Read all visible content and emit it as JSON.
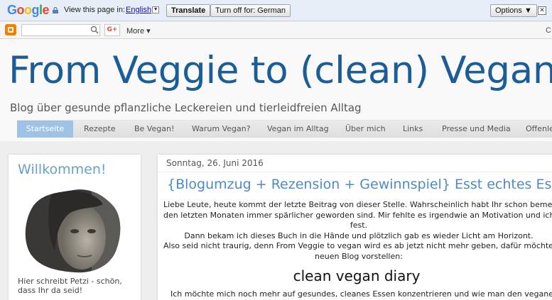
{
  "translate_bar": {
    "logo_letters": [
      "G",
      "o",
      "o",
      "g",
      "l",
      "e"
    ],
    "prompt": "View this page in:",
    "language": "English",
    "translate_label": "Translate",
    "turn_off_label": "Turn off for: German",
    "options_label": "Options ▼",
    "close_label": "✕"
  },
  "navbar": {
    "gplus_label": "G+",
    "more_label": "More ▾",
    "right_edge_text": "C"
  },
  "header": {
    "title": "From Veggie to (clean) Vegan",
    "description": "Blog über gesunde pflanzliche Leckereien und tierleidfreien Alltag"
  },
  "tabs": [
    {
      "label": "Startseite",
      "active": true
    },
    {
      "label": "Rezepte"
    },
    {
      "label": "Be Vegan!"
    },
    {
      "label": "Warum Vegan?"
    },
    {
      "label": "Vegan im Alltag"
    },
    {
      "label": "Über mich"
    },
    {
      "label": "Links"
    },
    {
      "label": "Presse und Media"
    },
    {
      "label": "Offenlegung"
    }
  ],
  "sidebar": {
    "title": "Willkommen!",
    "caption": "Hier schreibt Petzi - schön, dass Ihr da seid!"
  },
  "post": {
    "date": "Sonntag, 26. Juni 2016",
    "title": "{Blogumzug + Rezension + Gewinnspiel} Esst echtes Essen",
    "lines": [
      "Liebe Leute, heute kommt der letzte Beitrag von dieser Stelle. Wahrscheinlich habt Ihr schon bemerkt, dass",
      "den letzten Monaten immer spärlicher geworden sind. Mir fehlte es irgendwie an Motivation und ich steckte n",
      "fest.",
      "Dann bekam ich dieses Buch in die Hände und plötzlich gab es wieder Licht am Horizont.",
      "Also seid nicht traurig, denn From Veggie to vegan wird es ab jetzt nicht mehr geben, dafür möchte ich hier",
      "neuen Blog vorstellen:"
    ],
    "heading": "clean vegan diary",
    "after": "Ich möchte mich noch mehr auf gesundes, cleanes Essen konzentrieren und wie man den veganen Alltag ge"
  },
  "colors": {
    "title_blue": "#1a5d99",
    "active_tab": "#9fc3e6",
    "post_title": "#4d8ac8",
    "widget_title": "#6aa0c9"
  }
}
